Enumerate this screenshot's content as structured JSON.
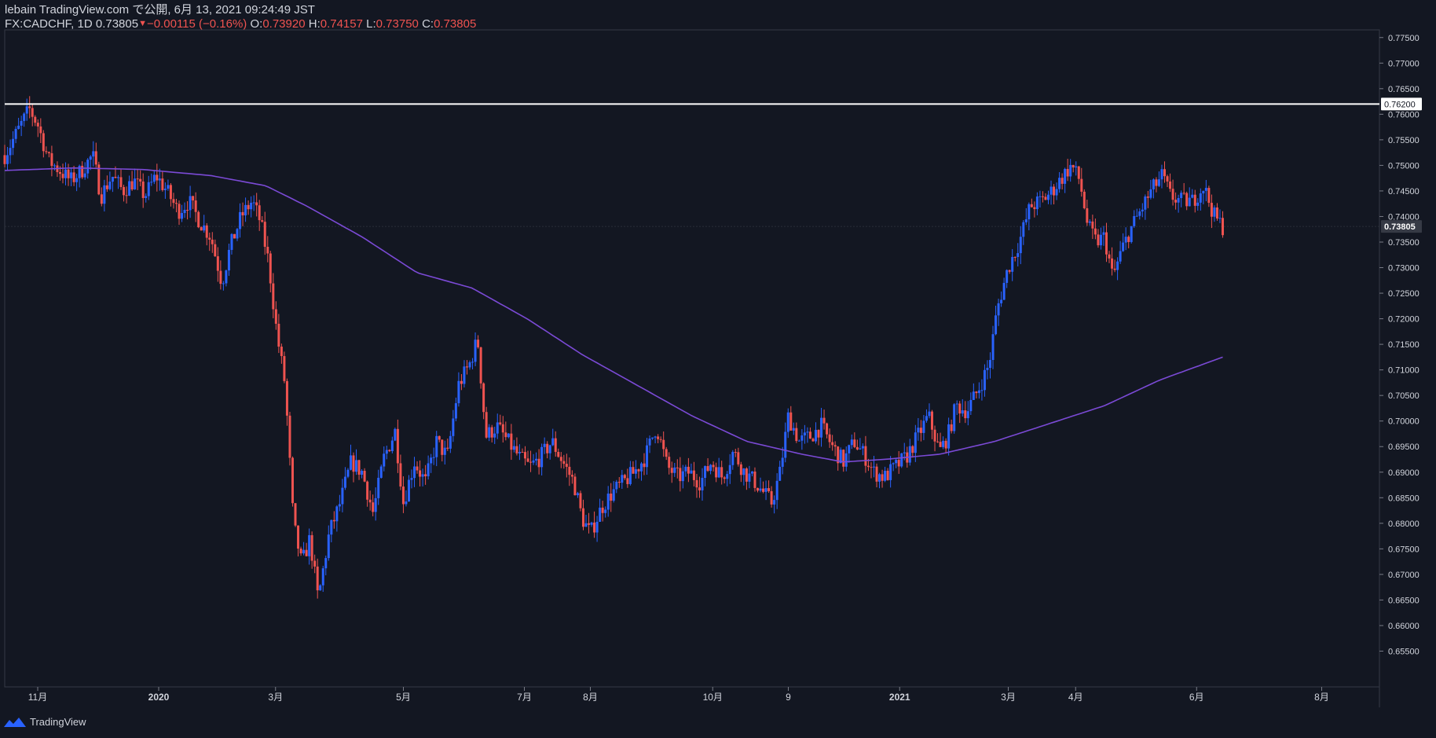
{
  "header": {
    "publish_line": "lebain TradingView.com で公開, 6月 13, 2021 09:24:49 JST",
    "symbol": "FX:CADCHF, 1D",
    "last": "0.73805",
    "change": "−0.00115 (−0.16%)",
    "o_label": "O:",
    "o_value": "0.73920",
    "h_label": "H:",
    "h_value": "0.74157",
    "l_label": "L:",
    "l_value": "0.73750",
    "c_label": "C:",
    "c_value": "0.73805"
  },
  "footer": {
    "brand": "TradingView"
  },
  "colors": {
    "background": "#131722",
    "up": "#2962ff",
    "down": "#ef5350",
    "ma": "#7b4ad6",
    "hline": "#ffffff",
    "axis_text": "#d1d4dc",
    "grid_border": "#363a45"
  },
  "chart_data": {
    "type": "candlestick",
    "symbol": "FX:CADCHF",
    "timeframe": "1D",
    "ylim": [
      0.648,
      0.7765
    ],
    "y_ticks": [
      "0.65500",
      "0.66000",
      "0.66500",
      "0.67000",
      "0.67500",
      "0.68000",
      "0.68500",
      "0.69000",
      "0.69500",
      "0.70000",
      "0.70500",
      "0.71000",
      "0.71500",
      "0.72000",
      "0.72500",
      "0.73000",
      "0.73500",
      "0.74000",
      "0.74500",
      "0.75000",
      "0.75500",
      "0.76000",
      "0.76500",
      "0.77000",
      "0.77500"
    ],
    "x_ticks": [
      {
        "label": "11月",
        "t": 0.024
      },
      {
        "label": "2020",
        "t": 0.112
      },
      {
        "label": "3月",
        "t": 0.197
      },
      {
        "label": "5月",
        "t": 0.29
      },
      {
        "label": "7月",
        "t": 0.378
      },
      {
        "label": "8月",
        "t": 0.426
      },
      {
        "label": "10月",
        "t": 0.515
      },
      {
        "label": "9",
        "t": 0.57
      },
      {
        "label": "2021",
        "t": 0.651
      },
      {
        "label": "3月",
        "t": 0.73
      },
      {
        "label": "4月",
        "t": 0.779
      },
      {
        "label": "6月",
        "t": 0.867
      },
      {
        "label": "8月",
        "t": 0.958
      }
    ],
    "horizontal_line": {
      "value": 0.762,
      "label": "0.76200"
    },
    "last_price": {
      "value": 0.73805,
      "label": "0.73805"
    },
    "close_path": [
      [
        0.0,
        0.752
      ],
      [
        0.01,
        0.757
      ],
      [
        0.018,
        0.761
      ],
      [
        0.024,
        0.758
      ],
      [
        0.032,
        0.751
      ],
      [
        0.04,
        0.749
      ],
      [
        0.048,
        0.747
      ],
      [
        0.056,
        0.749
      ],
      [
        0.064,
        0.752
      ],
      [
        0.07,
        0.744
      ],
      [
        0.078,
        0.748
      ],
      [
        0.086,
        0.745
      ],
      [
        0.094,
        0.747
      ],
      [
        0.102,
        0.744
      ],
      [
        0.11,
        0.748
      ],
      [
        0.118,
        0.745
      ],
      [
        0.126,
        0.741
      ],
      [
        0.134,
        0.743
      ],
      [
        0.142,
        0.739
      ],
      [
        0.15,
        0.736
      ],
      [
        0.158,
        0.727
      ],
      [
        0.164,
        0.734
      ],
      [
        0.172,
        0.74
      ],
      [
        0.18,
        0.743
      ],
      [
        0.186,
        0.739
      ],
      [
        0.192,
        0.731
      ],
      [
        0.198,
        0.717
      ],
      [
        0.204,
        0.707
      ],
      [
        0.21,
        0.68
      ],
      [
        0.216,
        0.672
      ],
      [
        0.222,
        0.677
      ],
      [
        0.228,
        0.665
      ],
      [
        0.236,
        0.678
      ],
      [
        0.244,
        0.684
      ],
      [
        0.252,
        0.692
      ],
      [
        0.26,
        0.69
      ],
      [
        0.268,
        0.682
      ],
      [
        0.276,
        0.693
      ],
      [
        0.284,
        0.698
      ],
      [
        0.29,
        0.684
      ],
      [
        0.298,
        0.692
      ],
      [
        0.306,
        0.688
      ],
      [
        0.314,
        0.696
      ],
      [
        0.322,
        0.693
      ],
      [
        0.33,
        0.707
      ],
      [
        0.338,
        0.711
      ],
      [
        0.344,
        0.716
      ],
      [
        0.35,
        0.697
      ],
      [
        0.358,
        0.699
      ],
      [
        0.366,
        0.696
      ],
      [
        0.374,
        0.693
      ],
      [
        0.382,
        0.691
      ],
      [
        0.39,
        0.693
      ],
      [
        0.398,
        0.696
      ],
      [
        0.406,
        0.692
      ],
      [
        0.414,
        0.688
      ],
      [
        0.42,
        0.681
      ],
      [
        0.426,
        0.678
      ],
      [
        0.434,
        0.683
      ],
      [
        0.442,
        0.686
      ],
      [
        0.45,
        0.688
      ],
      [
        0.458,
        0.69
      ],
      [
        0.466,
        0.693
      ],
      [
        0.474,
        0.699
      ],
      [
        0.482,
        0.691
      ],
      [
        0.49,
        0.689
      ],
      [
        0.498,
        0.69
      ],
      [
        0.506,
        0.688
      ],
      [
        0.514,
        0.692
      ],
      [
        0.522,
        0.689
      ],
      [
        0.53,
        0.694
      ],
      [
        0.538,
        0.69
      ],
      [
        0.546,
        0.688
      ],
      [
        0.552,
        0.686
      ],
      [
        0.558,
        0.684
      ],
      [
        0.564,
        0.69
      ],
      [
        0.57,
        0.701
      ],
      [
        0.578,
        0.696
      ],
      [
        0.586,
        0.697
      ],
      [
        0.594,
        0.699
      ],
      [
        0.602,
        0.695
      ],
      [
        0.61,
        0.692
      ],
      [
        0.618,
        0.696
      ],
      [
        0.626,
        0.693
      ],
      [
        0.632,
        0.69
      ],
      [
        0.64,
        0.689
      ],
      [
        0.648,
        0.691
      ],
      [
        0.656,
        0.693
      ],
      [
        0.664,
        0.697
      ],
      [
        0.672,
        0.701
      ],
      [
        0.68,
        0.694
      ],
      [
        0.686,
        0.697
      ],
      [
        0.692,
        0.703
      ],
      [
        0.7,
        0.702
      ],
      [
        0.708,
        0.706
      ],
      [
        0.716,
        0.711
      ],
      [
        0.722,
        0.722
      ],
      [
        0.73,
        0.73
      ],
      [
        0.738,
        0.735
      ],
      [
        0.746,
        0.742
      ],
      [
        0.754,
        0.743
      ],
      [
        0.762,
        0.745
      ],
      [
        0.77,
        0.748
      ],
      [
        0.776,
        0.75
      ],
      [
        0.782,
        0.747
      ],
      [
        0.788,
        0.738
      ],
      [
        0.794,
        0.735
      ],
      [
        0.8,
        0.736
      ],
      [
        0.806,
        0.728
      ],
      [
        0.812,
        0.733
      ],
      [
        0.818,
        0.737
      ],
      [
        0.826,
        0.741
      ],
      [
        0.834,
        0.745
      ],
      [
        0.842,
        0.748
      ],
      [
        0.848,
        0.744
      ],
      [
        0.856,
        0.743
      ],
      [
        0.864,
        0.743
      ],
      [
        0.872,
        0.746
      ],
      [
        0.876,
        0.743
      ],
      [
        0.88,
        0.74
      ],
      [
        0.886,
        0.738
      ]
    ],
    "moving_average": [
      [
        0.0,
        0.749
      ],
      [
        0.05,
        0.7495
      ],
      [
        0.1,
        0.7492
      ],
      [
        0.15,
        0.748
      ],
      [
        0.19,
        0.746
      ],
      [
        0.22,
        0.742
      ],
      [
        0.26,
        0.736
      ],
      [
        0.3,
        0.729
      ],
      [
        0.34,
        0.726
      ],
      [
        0.38,
        0.72
      ],
      [
        0.42,
        0.713
      ],
      [
        0.46,
        0.707
      ],
      [
        0.5,
        0.701
      ],
      [
        0.54,
        0.696
      ],
      [
        0.58,
        0.6935
      ],
      [
        0.61,
        0.692
      ],
      [
        0.64,
        0.6925
      ],
      [
        0.68,
        0.6935
      ],
      [
        0.72,
        0.696
      ],
      [
        0.76,
        0.6995
      ],
      [
        0.8,
        0.703
      ],
      [
        0.84,
        0.708
      ],
      [
        0.886,
        0.7125
      ]
    ]
  }
}
